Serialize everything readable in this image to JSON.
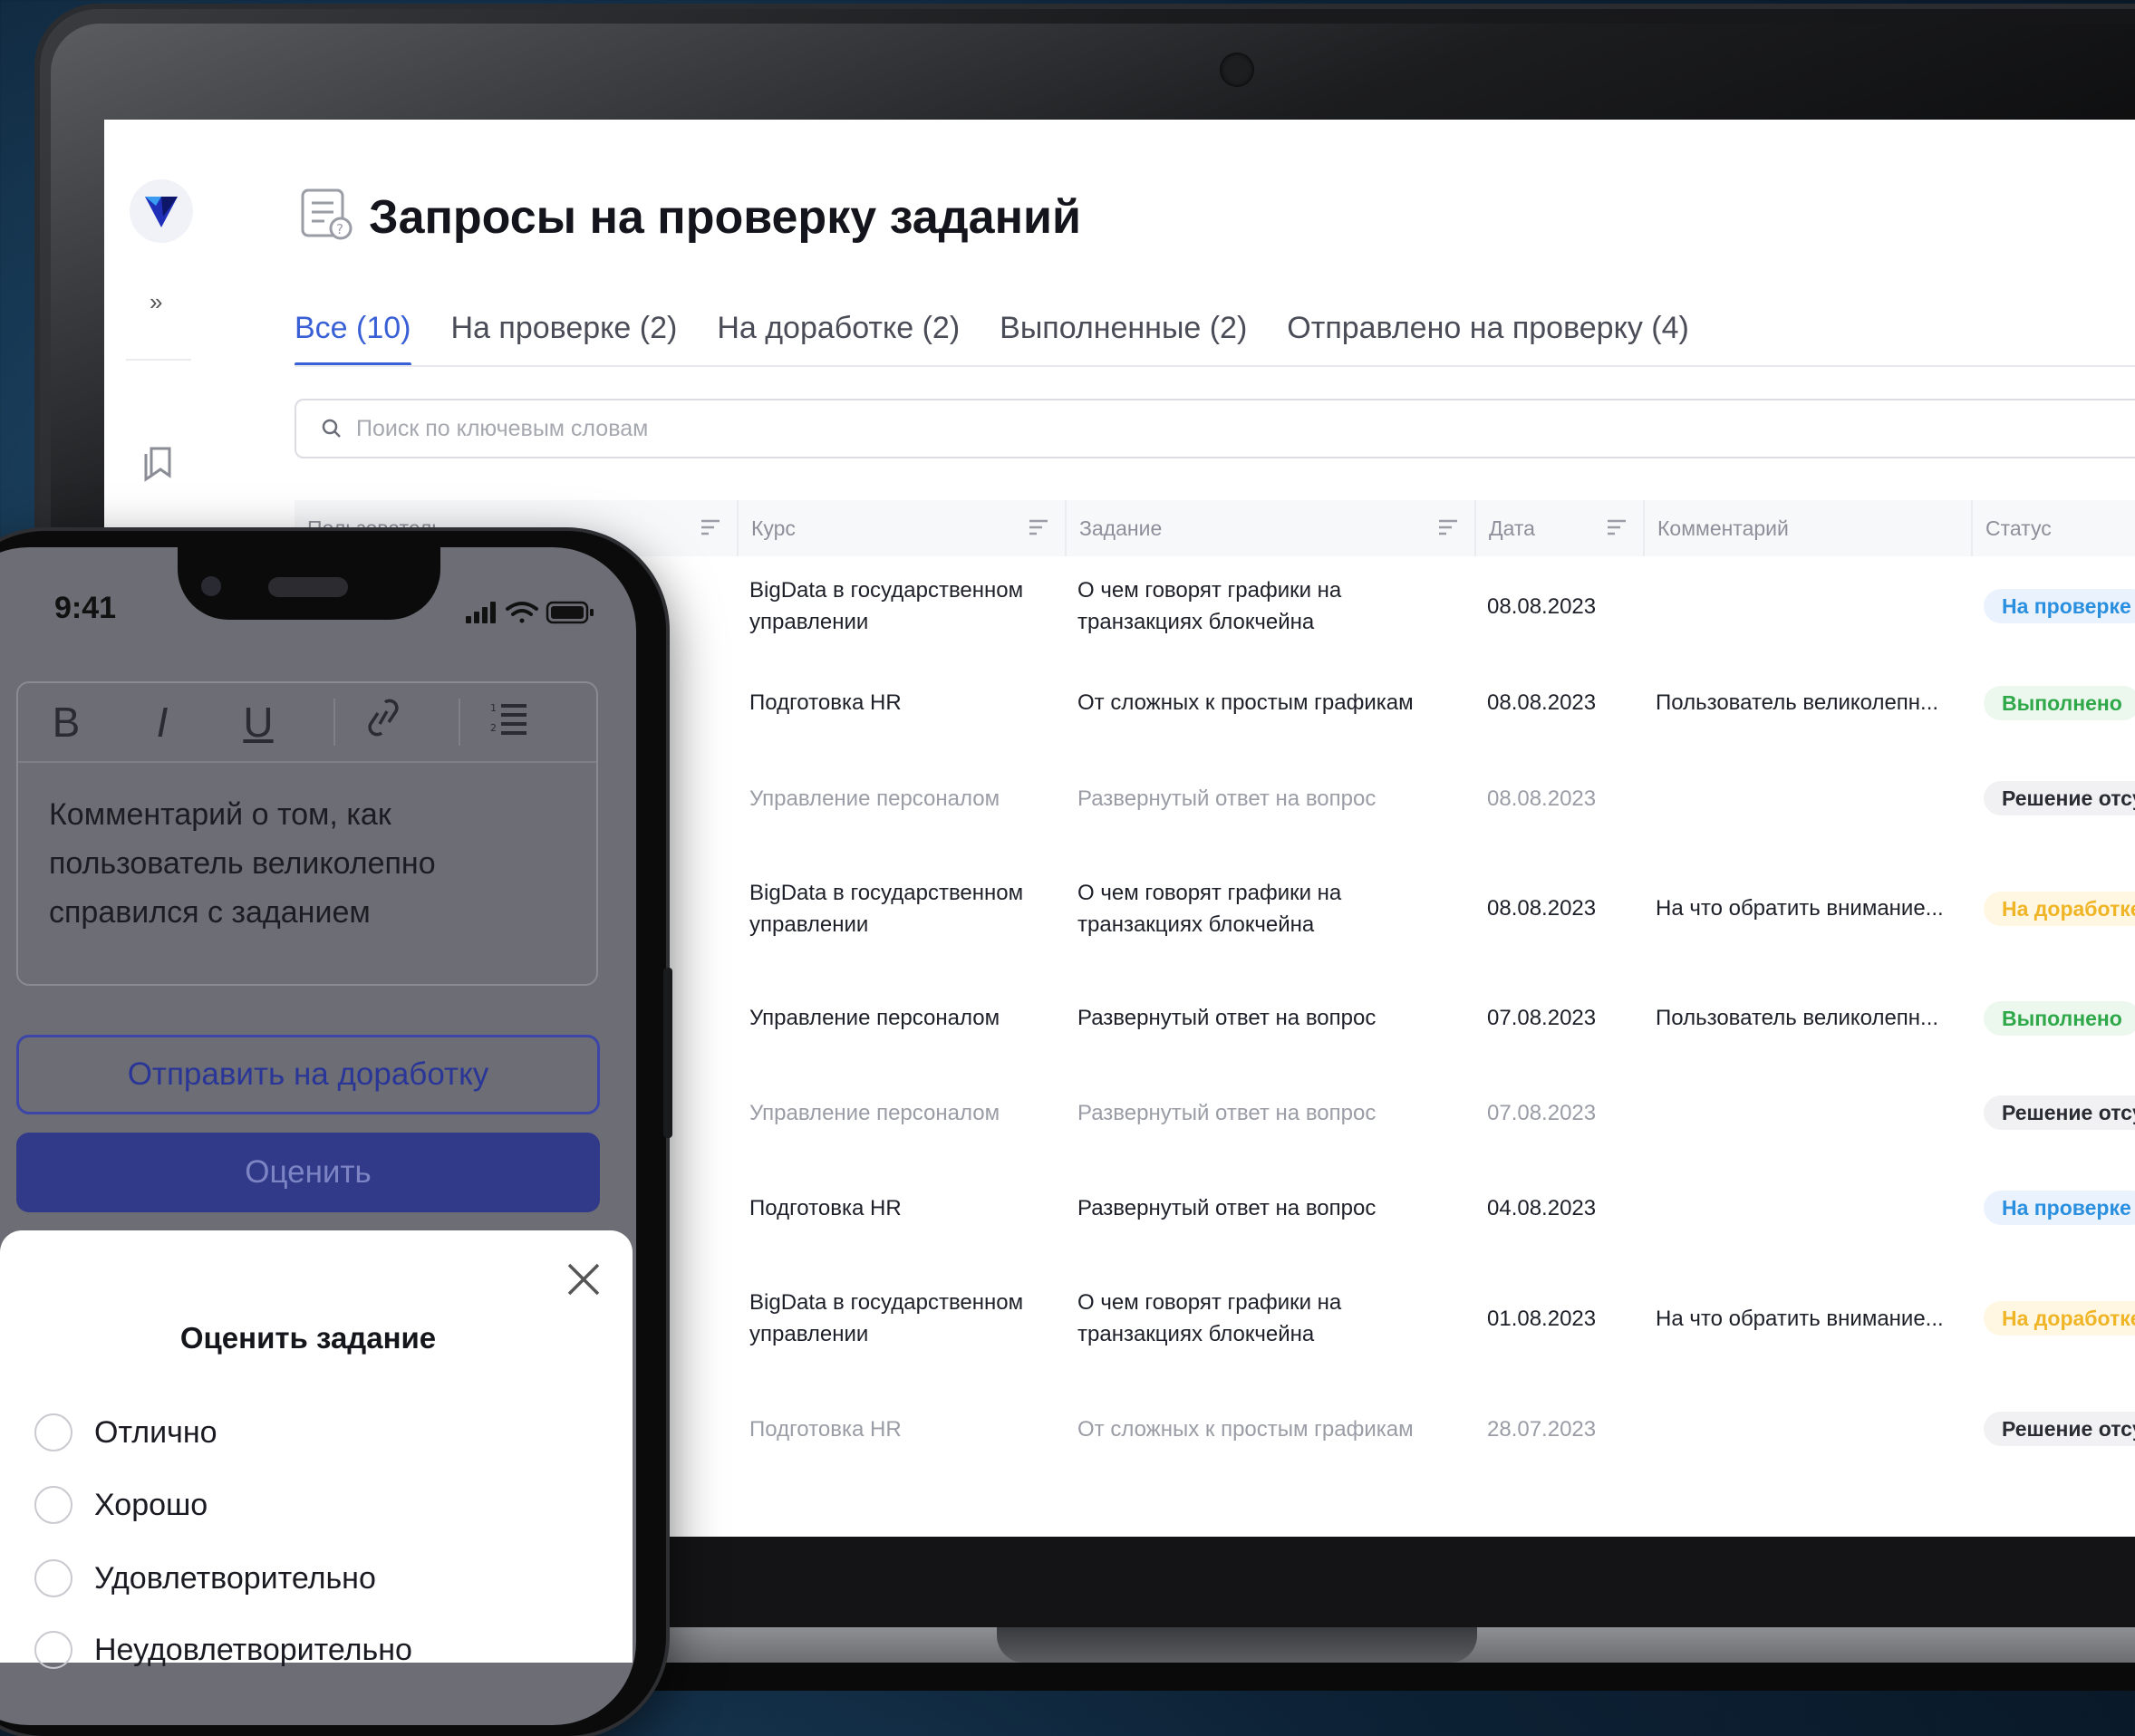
{
  "page": {
    "title": "Запросы на проверку заданий",
    "search_placeholder": "Поиск по ключевым словам"
  },
  "tabs": [
    {
      "label": "Все (10)",
      "active": true
    },
    {
      "label": "На проверке (2)",
      "active": false
    },
    {
      "label": "На доработке (2)",
      "active": false
    },
    {
      "label": "Выполненные (2)",
      "active": false
    },
    {
      "label": "Отправлено на проверку (4)",
      "active": false
    }
  ],
  "table": {
    "columns": [
      "Пользователь",
      "Курс",
      "Задание",
      "Дата",
      "Комментарий",
      "Статус"
    ],
    "rows": [
      {
        "course": "BigData в государственном управлении",
        "task": "О чем говорят графики на транзакциях блокчейна",
        "date": "08.08.2023",
        "comment": "",
        "status": "На проверке",
        "status_type": "blue",
        "muted": false
      },
      {
        "course": "Подготовка HR",
        "task": "От сложных к простым графикам",
        "date": "08.08.2023",
        "comment": "Пользователь великолепн...",
        "status": "Выполнено",
        "status_type": "green",
        "muted": false
      },
      {
        "course": "Управление персоналом",
        "task": "Развернутый ответ на вопрос",
        "date": "08.08.2023",
        "comment": "",
        "status": "Решение отсу",
        "status_type": "gray",
        "muted": true
      },
      {
        "course": "BigData в государственном управлении",
        "task": "О чем говорят графики на транзакциях блокчейна",
        "date": "08.08.2023",
        "comment": "На что обратить внимание...",
        "status": "На доработке",
        "status_type": "yellow",
        "muted": false
      },
      {
        "course": "Управление персоналом",
        "task": "Развернутый ответ на вопрос",
        "date": "07.08.2023",
        "comment": "Пользователь великолепн...",
        "status": "Выполнено",
        "status_type": "green",
        "muted": false
      },
      {
        "course": "Управление персоналом",
        "task": "Развернутый ответ на вопрос",
        "date": "07.08.2023",
        "comment": "",
        "status": "Решение отсу",
        "status_type": "gray",
        "muted": true
      },
      {
        "course": "Подготовка HR",
        "task": "Развернутый ответ на вопрос",
        "date": "04.08.2023",
        "comment": "",
        "status": "На проверке",
        "status_type": "blue",
        "muted": false
      },
      {
        "course": "BigData в государственном управлении",
        "task": "О чем говорят графики на транзакциях блокчейна",
        "date": "01.08.2023",
        "comment": "На что обратить внимание...",
        "status": "На доработке",
        "status_type": "yellow",
        "muted": false
      },
      {
        "course": "Подготовка HR",
        "task": "От сложных к простым графикам",
        "date": "28.07.2023",
        "comment": "",
        "status": "Решение отсу",
        "status_type": "gray",
        "muted": true
      }
    ]
  },
  "phone": {
    "time": "9:41",
    "toolbar": [
      "B",
      "I",
      "U"
    ],
    "comment_text": "Комментарий о том, как пользователь великолепно справился с заданием",
    "send_back_button": "Отправить на доработку",
    "rate_button": "Оценить",
    "sheet_title": "Оценить задание",
    "grades": [
      "Отлично",
      "Хорошо",
      "Удовлетворительно",
      "Неудовлетворительно"
    ]
  },
  "colors": {
    "accent": "#3a60d6",
    "primary_button": "#313a88",
    "status_blue": "#2b8fe0",
    "status_green": "#2fa84a",
    "status_yellow": "#f0b526"
  }
}
